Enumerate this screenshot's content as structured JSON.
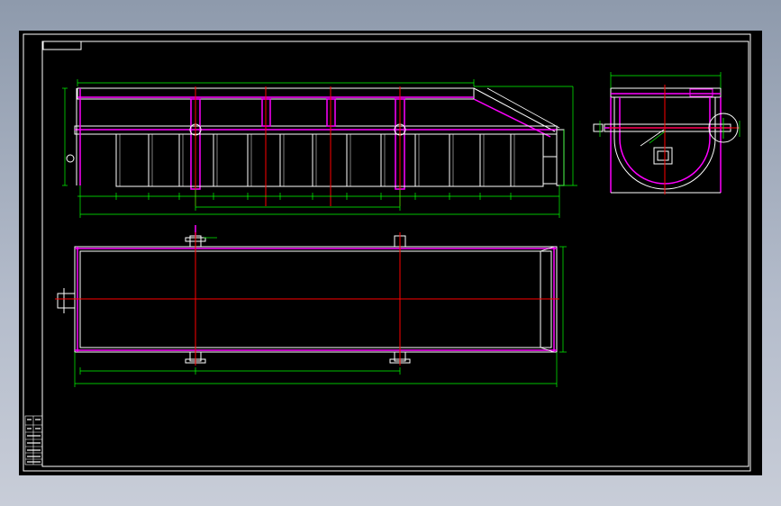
{
  "drawing": {
    "background": "#000000",
    "colors": {
      "outline": "#ffffff",
      "structure": "#ff00ff",
      "dimension": "#00ff00",
      "centerline": "#ff0000",
      "frame": "#ffffff"
    },
    "views": [
      {
        "name": "front-view",
        "parts": [
          "frame-rail",
          "cross-supports",
          "tank-segments",
          "dimension-lines"
        ]
      },
      {
        "name": "side-view",
        "parts": [
          "u-trough",
          "top-rail",
          "detail-circle"
        ]
      },
      {
        "name": "top-view",
        "parts": [
          "tank-outline",
          "mounting-lugs",
          "end-flange"
        ]
      }
    ],
    "title_block_rows": 7
  }
}
